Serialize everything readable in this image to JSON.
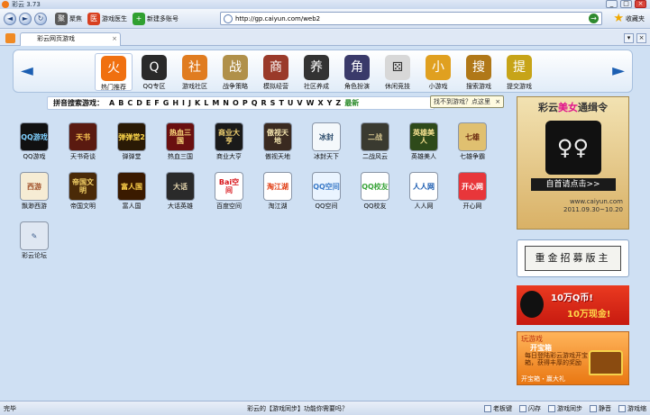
{
  "window": {
    "title": "彩云 3.73",
    "min": "_",
    "max": "□",
    "close": "×"
  },
  "toolbar": {
    "back": "◄",
    "forward": "►",
    "refresh": "↻",
    "items": [
      {
        "label": "聚焦",
        "color": "#5a5a5a",
        "glyph": "聚"
      },
      {
        "label": "游戏医生",
        "color": "#d84020",
        "glyph": "医"
      },
      {
        "label": "新建多账号",
        "color": "#30a030",
        "glyph": "+"
      }
    ]
  },
  "address": {
    "url": "http://gp.caiyun.com/web2",
    "go": "→"
  },
  "favorites": {
    "label": "收藏夹"
  },
  "tab": {
    "label": "彩云网页游戏",
    "close": "×"
  },
  "categories": [
    {
      "label": "热门推荐",
      "color": "#f07010",
      "glyph": "火"
    },
    {
      "label": "QQ专区",
      "color": "#2a2a2a",
      "glyph": "Q"
    },
    {
      "label": "游戏社区",
      "color": "#e07c20",
      "glyph": "社"
    },
    {
      "label": "战争策略",
      "color": "#b0904a",
      "glyph": "战"
    },
    {
      "label": "模拟经营",
      "color": "#9a3a2a",
      "glyph": "商"
    },
    {
      "label": "社区养成",
      "color": "#333333",
      "glyph": "养"
    },
    {
      "label": "角色扮演",
      "color": "#3a3a6a",
      "glyph": "角"
    },
    {
      "label": "休闲竞技",
      "color": "#d8d8d8",
      "glyph": "⚄"
    },
    {
      "label": "小游戏",
      "color": "#e0a020",
      "glyph": "小"
    },
    {
      "label": "搜索游戏",
      "color": "#b07818",
      "glyph": "搜"
    },
    {
      "label": "提交游戏",
      "color": "#c7a418",
      "glyph": "提"
    }
  ],
  "nav": {
    "prev": "◄",
    "next": "►"
  },
  "alphabet": {
    "label": "拼音搜索游戏：",
    "letters": [
      "A",
      "B",
      "C",
      "D",
      "E",
      "F",
      "G",
      "H",
      "I",
      "J",
      "K",
      "L",
      "M",
      "N",
      "O",
      "P",
      "Q",
      "R",
      "S",
      "T",
      "U",
      "V",
      "W",
      "X",
      "Y",
      "Z"
    ],
    "latest": "最新"
  },
  "tooltip": {
    "text": "找不到游戏？点这里",
    "close": "×"
  },
  "games": [
    {
      "label": "QQ游戏",
      "bg": "#111",
      "fg": "#7fd0ff",
      "txt": "QQ游戏"
    },
    {
      "label": "天书奇谈",
      "bg": "#5a1a10",
      "fg": "#ffcc55",
      "txt": "天书"
    },
    {
      "label": "弹弹堂",
      "bg": "#2a1a05",
      "fg": "#ffd84a",
      "txt": "弹弹堂2"
    },
    {
      "label": "热血三国",
      "bg": "#6a1010",
      "fg": "#ffe080",
      "txt": "热血三国"
    },
    {
      "label": "商业大亨",
      "bg": "#1a1a1a",
      "fg": "#f0d070",
      "txt": "商业大亨"
    },
    {
      "label": "傲视天地",
      "bg": "#3a2a20",
      "fg": "#f5e6b0",
      "txt": "傲视天地"
    },
    {
      "label": "冰封天下",
      "bg": "#f4f8fb",
      "fg": "#2a4a6a",
      "txt": "冰封"
    },
    {
      "label": "二战风云",
      "bg": "#3a3a30",
      "fg": "#d8c890",
      "txt": "二战"
    },
    {
      "label": "英雄美人",
      "bg": "#2e4a1a",
      "fg": "#f5e090",
      "txt": "英雄美人"
    },
    {
      "label": "七雄争霸",
      "bg": "#e0c070",
      "fg": "#6a2a10",
      "txt": "七雄"
    },
    {
      "label": "飘渺西游",
      "bg": "#f6ecd4",
      "fg": "#a0502a",
      "txt": "西游"
    },
    {
      "label": "帝国文明",
      "bg": "#4a2a08",
      "fg": "#f7d56a",
      "txt": "帝国文明"
    },
    {
      "label": "富人国",
      "bg": "#3a1a00",
      "fg": "#ffd24a",
      "txt": "富人国"
    },
    {
      "label": "大话英雄",
      "bg": "#2a2a2a",
      "fg": "#e8d8b0",
      "txt": "大话"
    },
    {
      "label": "百度空间",
      "bg": "#ffffff",
      "fg": "#d8141a",
      "txt": "Bai空间"
    },
    {
      "label": "淘江湖",
      "bg": "#ffffff",
      "fg": "#e03a10",
      "txt": "淘江湖"
    },
    {
      "label": "QQ空间",
      "bg": "#eaf4ff",
      "fg": "#3a7ac8",
      "txt": "QQ空间"
    },
    {
      "label": "QQ校友",
      "bg": "#ffffff",
      "fg": "#3aa43a",
      "txt": "QQ校友"
    },
    {
      "label": "人人网",
      "bg": "#ffffff",
      "fg": "#1a5bb0",
      "txt": "人人网"
    },
    {
      "label": "开心网",
      "bg": "#e8363a",
      "fg": "#ffffff",
      "txt": "开心网"
    },
    {
      "label": "彩云论坛",
      "bg": "#dfe7f2",
      "fg": "#3a5a8a",
      "txt": "✎"
    }
  ],
  "ads": {
    "promo": {
      "pre": "彩云",
      "hl": "美女",
      "post": "通缉令",
      "cta": "自首请点击>>",
      "url": "www.caiyun.com",
      "date": "2011.09.30~10.20"
    },
    "recruit": {
      "text": "重金招募版主"
    },
    "qq": {
      "line1": "10万Q币!",
      "line2": "10万现金!"
    },
    "box": {
      "brand": "玩游戏",
      "title": "开宝箱",
      "desc": "每日登陆彩云游戏开宝箱，获得丰厚的奖励",
      "foot": "开宝箱・赢大礼"
    }
  },
  "status": {
    "left": "完毕",
    "center": "彩云的【游戏同步】功能你需要吗？",
    "items": [
      "老板键",
      "闪存",
      "游戏同步",
      "静音",
      "游戏缩"
    ]
  }
}
